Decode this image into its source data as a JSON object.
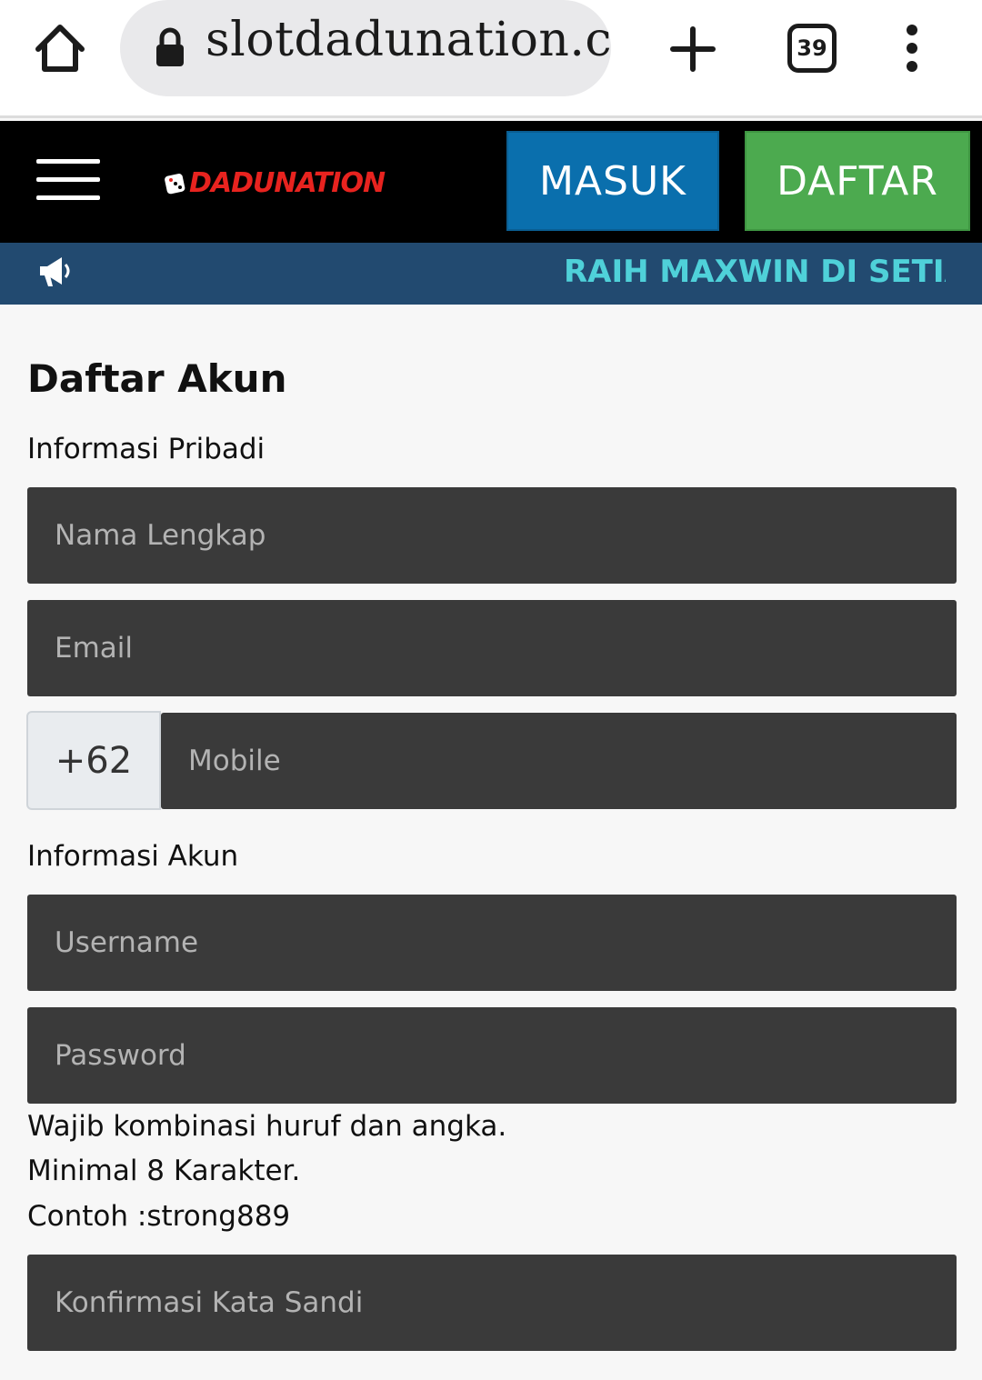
{
  "browser": {
    "url": "slotdadunation.co",
    "tab_count": "39",
    "icons": [
      "home-icon",
      "lock-icon",
      "plus-icon",
      "tab-switcher-icon",
      "more-vert-icon"
    ]
  },
  "header": {
    "logo_text": "DADUNATION",
    "login_label": "MASUK",
    "register_label": "DAFTAR"
  },
  "announcement": {
    "text": "RAIH MAXWIN DI SETIAP"
  },
  "form": {
    "title": "Daftar Akun",
    "personal_section": "Informasi Pribadi",
    "full_name_placeholder": "Nama Lengkap",
    "email_placeholder": "Email",
    "phone_prefix": "+62",
    "mobile_placeholder": "Mobile",
    "account_section": "Informasi Akun",
    "username_placeholder": "Username",
    "password_placeholder": "Password",
    "password_hint_1": "Wajib kombinasi huruf dan angka.",
    "password_hint_2": "Minimal 8 Karakter.",
    "password_hint_3": "Contoh :strong889",
    "confirm_password_placeholder": "Konfirmasi Kata Sandi"
  },
  "colors": {
    "login_button": "#0a6fad",
    "register_button": "#4caa4f",
    "announcement_bar": "#224a70",
    "announcement_text": "#4fd1d9",
    "logo": "#e8231f",
    "input_bg": "#3a3a3a"
  }
}
